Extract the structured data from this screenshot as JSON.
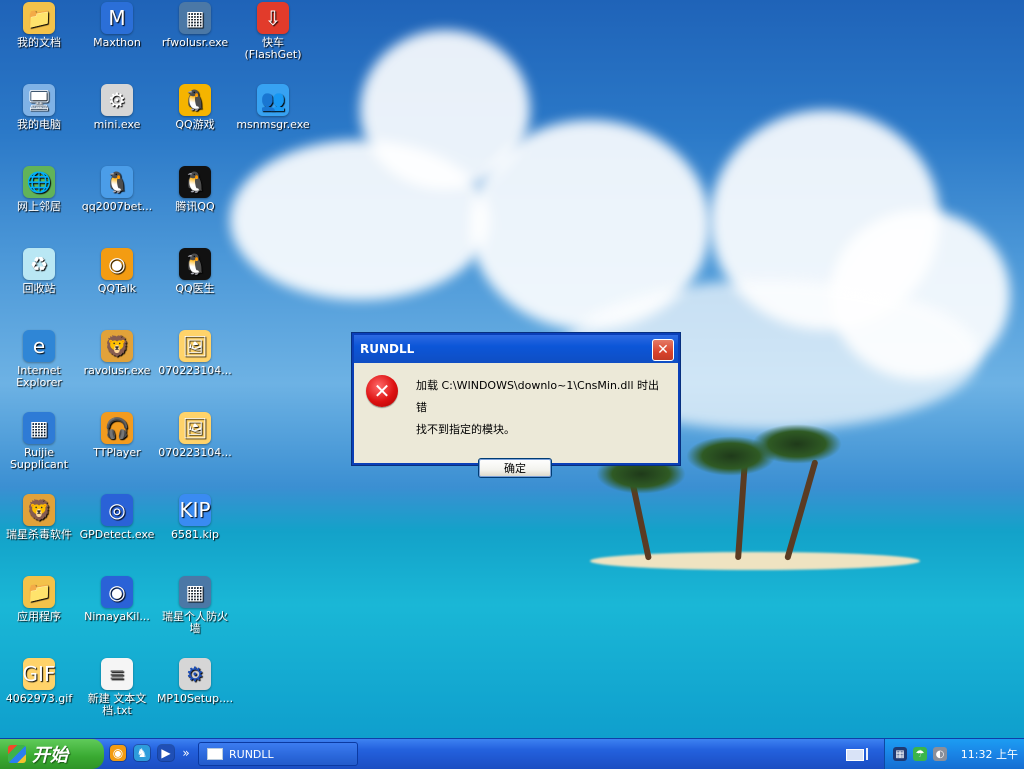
{
  "desktop": {
    "icons": [
      {
        "label": "我的文档",
        "icon": "folder-icon"
      },
      {
        "label": "Maxthon",
        "icon": "maxthon-icon"
      },
      {
        "label": "rfwolusr.exe",
        "icon": "firewall-icon"
      },
      {
        "label": "快车\n(FlashGet)",
        "icon": "flashget-icon"
      },
      {
        "label": "我的电脑",
        "icon": "computer-icon"
      },
      {
        "label": "mini.exe",
        "icon": "installer-icon"
      },
      {
        "label": "QQ游戏",
        "icon": "qq-games-icon"
      },
      {
        "label": "msnmsgr.exe",
        "icon": "msn-icon"
      },
      {
        "label": "网上邻居",
        "icon": "network-icon"
      },
      {
        "label": "qq2007bet...",
        "icon": "qq-installer-icon"
      },
      {
        "label": "腾讯QQ",
        "icon": "qq-icon"
      },
      {
        "label": "回收站",
        "icon": "recycle-bin-icon"
      },
      {
        "label": "QQTalk",
        "icon": "qqtalk-icon"
      },
      {
        "label": "QQ医生",
        "icon": "qq-doctor-icon"
      },
      {
        "label": "Internet\nExplorer",
        "icon": "ie-icon"
      },
      {
        "label": "ravolusr.exe",
        "icon": "antivirus-icon"
      },
      {
        "label": "070223104...",
        "icon": "jpg-file-icon"
      },
      {
        "label": "Ruijie\nSupplicant",
        "icon": "ruijie-icon"
      },
      {
        "label": "TTPlayer",
        "icon": "ttplayer-icon"
      },
      {
        "label": "070223104...",
        "icon": "jpg-file-icon"
      },
      {
        "label": "瑞星杀毒软件",
        "icon": "rising-antivirus-icon"
      },
      {
        "label": "GPDetect.exe",
        "icon": "gpdetect-icon"
      },
      {
        "label": "6581.kip",
        "icon": "kip-file-icon"
      },
      {
        "label": "应用程序",
        "icon": "folder-icon"
      },
      {
        "label": "NimayaKil...",
        "icon": "app-icon"
      },
      {
        "label": "瑞星个人防火\n墙",
        "icon": "rising-firewall-icon"
      },
      {
        "label": "4062973.gif",
        "icon": "gif-file-icon"
      },
      {
        "label": "新建 文本文\n档.txt",
        "icon": "text-file-icon"
      },
      {
        "label": "MP10Setup....",
        "icon": "setup-icon"
      }
    ]
  },
  "dialog": {
    "title": "RUNDLL",
    "close_glyph": "✕",
    "message_line1": "加载 C:\\WINDOWS\\downlo~1\\CnsMin.dll 时出错",
    "message_line2": "找不到指定的模块。",
    "ok_label": "确定",
    "error_glyph": "✕"
  },
  "taskbar": {
    "start_label": "开始",
    "quicklaunch": [
      {
        "name": "quicklaunch-1-icon",
        "glyph": "◉",
        "color": "#f39c12"
      },
      {
        "name": "quicklaunch-2-icon",
        "glyph": "♞",
        "color": "#2d9cdb"
      },
      {
        "name": "quicklaunch-3-icon",
        "glyph": "▶",
        "color": "#1f4fb6"
      }
    ],
    "quicklaunch_more": "»",
    "task_button_label": "RUNDLL",
    "tray_time": "11:32 上午"
  }
}
